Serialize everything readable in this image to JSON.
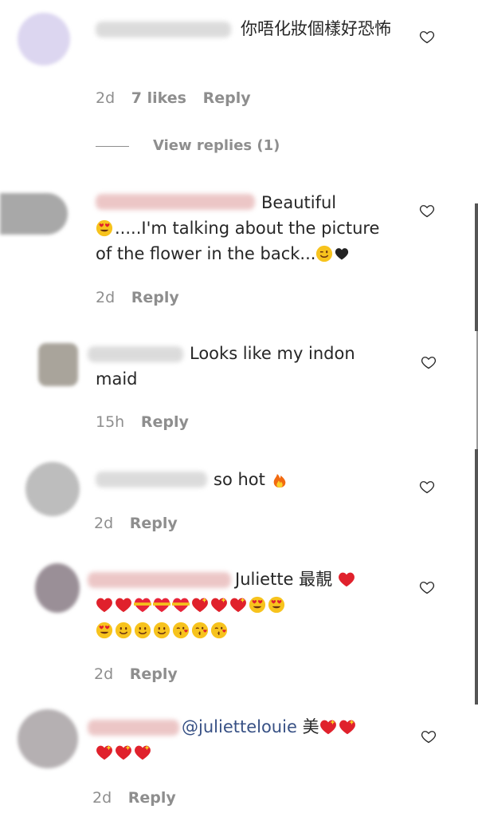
{
  "comments": [
    {
      "text": "你唔化妝個樣好恐怖",
      "date": "2d",
      "likes": "7 likes",
      "reply": "Reply",
      "view_replies": "View replies (1)"
    },
    {
      "text_1": "Beautiful",
      "text_2": ".....I'm talking about the picture",
      "text_3": "of the flower in the back...",
      "date": "2d",
      "reply": "Reply"
    },
    {
      "text": "Looks like my indon maid",
      "date": "15h",
      "reply": "Reply"
    },
    {
      "text": "so hot",
      "date": "2d",
      "reply": "Reply"
    },
    {
      "text": "Juliette 最靚",
      "date": "2d",
      "reply": "Reply"
    },
    {
      "mention": "@juliettelouie",
      "text": "美",
      "date": "2d",
      "reply": "Reply"
    }
  ],
  "icons": {
    "like": "heart-outline-icon",
    "fire": "fire-icon",
    "heart_eyes": "heart-eyes-emoji",
    "red_heart": "red-heart-emoji",
    "black_heart": "black-heart-emoji",
    "smile": "smiling-face-emoji",
    "kiss": "face-blowing-kiss-emoji",
    "sparkling_heart": "sparkling-heart-emoji",
    "ribbon_heart": "heart-with-ribbon-emoji",
    "wink": "winking-face-emoji"
  },
  "colors": {
    "text": "#262626",
    "meta": "#8e8e8e",
    "mention": "#385185"
  }
}
